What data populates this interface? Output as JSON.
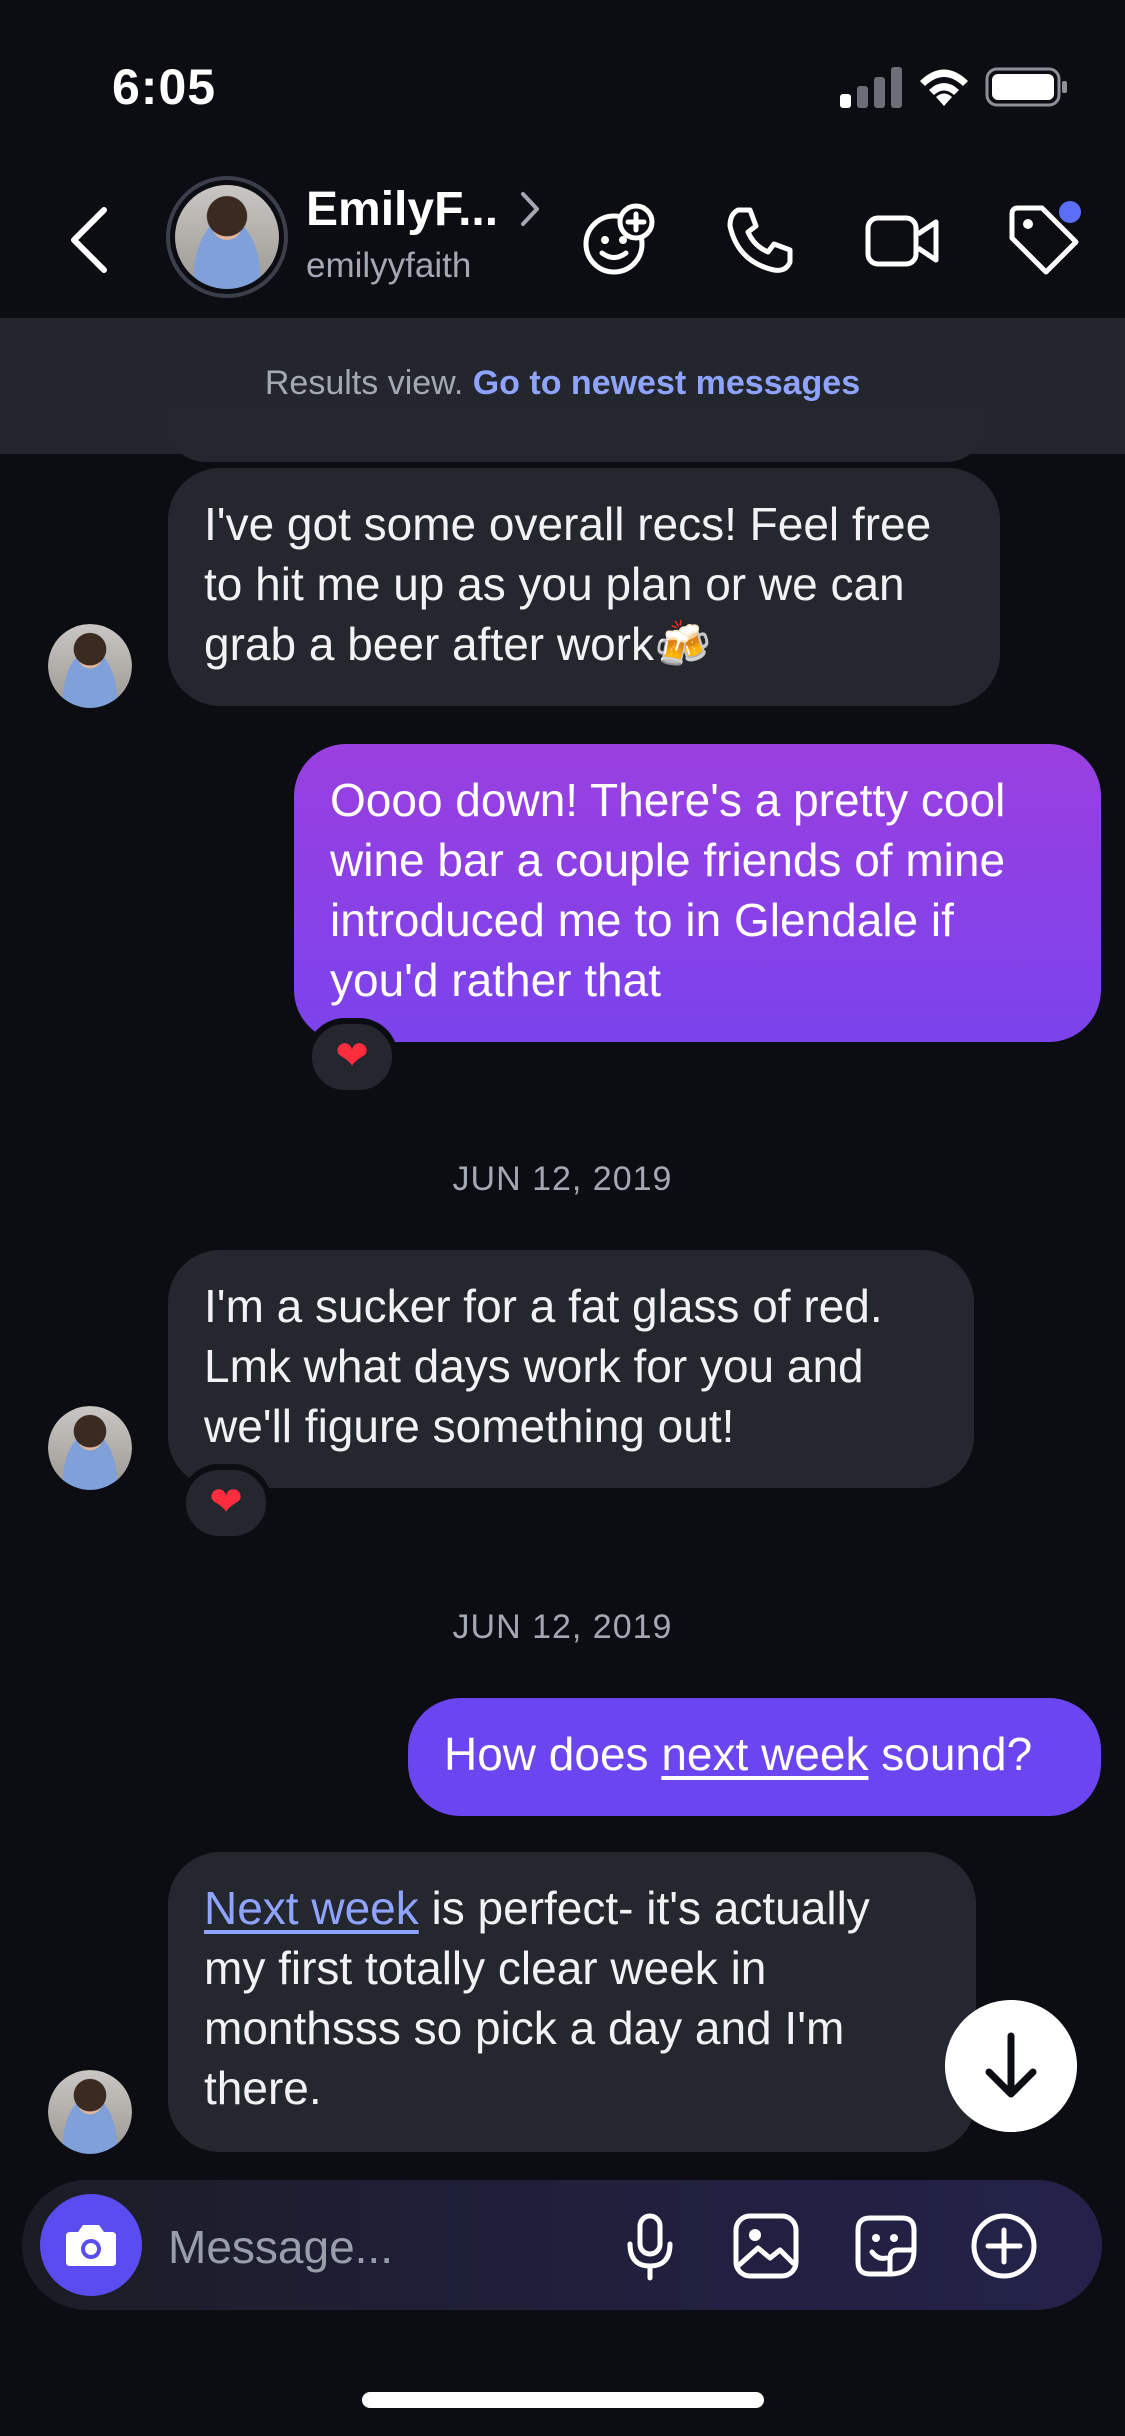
{
  "status_bar": {
    "time": "6:05"
  },
  "header": {
    "contact_name": "EmilyF...",
    "contact_handle": "emilyyfaith"
  },
  "banner": {
    "label": "Results view.",
    "link": "Go to newest messages"
  },
  "messages": [
    {
      "direction": "in",
      "text": "I've got some overall recs! Feel free to hit me up as you plan or we can grab a beer after work🍻"
    },
    {
      "direction": "out",
      "text": "Oooo down! There's a pretty cool wine bar a couple friends of mine introduced me to in Glendale if you'd rather that",
      "reaction": "❤"
    },
    {
      "direction": "in",
      "text": "I'm a sucker for a fat glass of red. Lmk what days work for you and we'll figure something out!",
      "reaction": "❤"
    },
    {
      "direction": "out",
      "text_before": "How does ",
      "text_link": "next week",
      "text_after": " sound?"
    },
    {
      "direction": "in",
      "text_link": "Next week",
      "text_after": " is perfect- it's actually my first totally clear week in monthsss so pick a day and I'm there."
    }
  ],
  "date_separators": [
    "JUN 12, 2019",
    "JUN 12, 2019"
  ],
  "composer": {
    "placeholder": "Message..."
  },
  "colors": {
    "background": "#0b0d12",
    "incoming_bubble": "#24272e",
    "outgoing_bubble_1": "#8b3fe6",
    "outgoing_bubble_2": "#6b45ef",
    "link": "#8ea4ff",
    "notification_dot": "#5b6ef7"
  },
  "icons": [
    "back-chevron",
    "sticker-plus",
    "phone",
    "video-camera",
    "tag",
    "camera",
    "microphone",
    "image",
    "sticker",
    "plus-circle",
    "arrow-down"
  ]
}
